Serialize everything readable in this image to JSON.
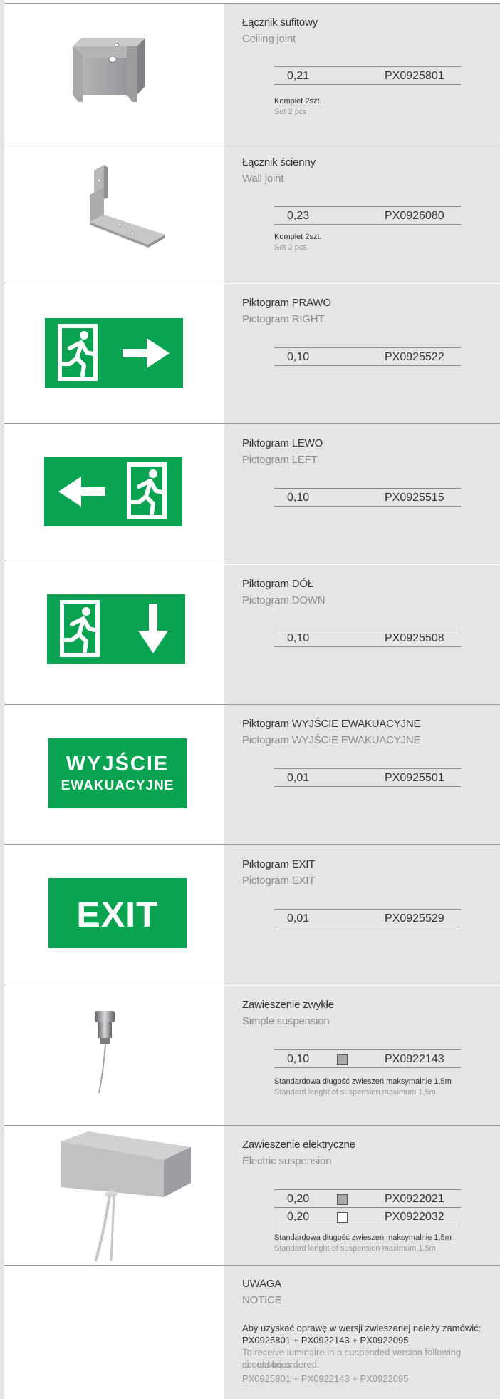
{
  "products": [
    {
      "name_pl": "Łącznik sufitowy",
      "name_en": "Ceiling joint",
      "icon": "ceiling-joint-bracket-icon",
      "specs": [
        {
          "weight": "0,21",
          "code": "PX0925801"
        }
      ],
      "note_pl": "Komplet 2szt.",
      "note_en": "Set 2 pcs."
    },
    {
      "name_pl": "Łącznik ścienny",
      "name_en": "Wall joint",
      "icon": "wall-joint-bracket-icon",
      "specs": [
        {
          "weight": "0,23",
          "code": "PX0926080"
        }
      ],
      "note_pl": "Komplet 2szt.",
      "note_en": "Set 2 pcs."
    },
    {
      "name_pl": "Piktogram PRAWO",
      "name_en": "Pictogram RIGHT",
      "icon": "exit-right-pictogram-icon",
      "specs": [
        {
          "weight": "0,10",
          "code": "PX0925522"
        }
      ]
    },
    {
      "name_pl": "Piktogram LEWO",
      "name_en": "Pictogram LEFT",
      "icon": "exit-left-pictogram-icon",
      "specs": [
        {
          "weight": "0,10",
          "code": "PX0925515"
        }
      ]
    },
    {
      "name_pl": "Piktogram DÓŁ",
      "name_en": "Pictogram DOWN",
      "icon": "exit-down-pictogram-icon",
      "specs": [
        {
          "weight": "0,10",
          "code": "PX0925508"
        }
      ]
    },
    {
      "name_pl": "Piktogram WYJŚCIE EWAKUACYJNE",
      "name_en": "Pictogram WYJŚCIE EWAKUACYJNE",
      "sign_line1": "WYJŚCIE",
      "sign_line2": "EWAKUACYJNE",
      "specs": [
        {
          "weight": "0,01",
          "code": "PX0925501"
        }
      ]
    },
    {
      "name_pl": "Piktogram EXIT",
      "name_en": "Pictogram EXIT",
      "sign_line1": "EXIT",
      "specs": [
        {
          "weight": "0,01",
          "code": "PX0925529"
        }
      ]
    },
    {
      "name_pl": "Zawieszenie zwykłe",
      "name_en": "Simple suspension",
      "icon": "simple-suspension-icon",
      "specs": [
        {
          "weight": "0,10",
          "swatch": "#a9a9a9",
          "code": "PX0922143"
        }
      ],
      "note_pl": "Standardowa długość zwieszeń maksymalnie 1,5m",
      "note_en": "Standard lenght of suspension maximum 1,5m"
    },
    {
      "name_pl": "Zawieszenie elektryczne",
      "name_en": "Electric suspension",
      "icon": "electric-suspension-icon",
      "specs": [
        {
          "weight": "0,20",
          "swatch": "#a9a9a9",
          "code": "PX0922021"
        },
        {
          "weight": "0,20",
          "swatch": "#ffffff",
          "code": "PX0922032"
        }
      ],
      "note_pl": "Standardowa długość zwieszeń maksymalnie 1,5m",
      "note_en": "Standard lenght of suspension maximum 1,5m"
    }
  ],
  "notice": {
    "title_pl": "UWAGA",
    "title_en": "NOTICE",
    "text_pl_1": "Aby uzyskać oprawę w wersji zwieszanej należy zamówić:",
    "text_pl_2": "PX0925801 + PX0922143 + PX0922095",
    "text_en_1": "To receive luminaire in a suspended version following accessories",
    "text_en_2": "should be ordered:",
    "text_en_3": "PX0925801 + PX0922143 + PX0922095"
  },
  "colors": {
    "sign_green": "#0aa351",
    "panel_grey": "#e4e5e6",
    "rule": "#9a9a9a"
  }
}
